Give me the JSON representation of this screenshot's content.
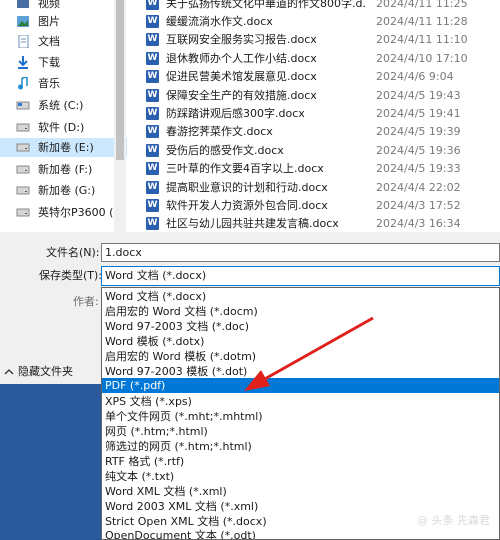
{
  "nav": {
    "items": [
      {
        "label": "视频",
        "icon": "video-icon"
      },
      {
        "label": "图片",
        "icon": "picture-icon"
      },
      {
        "label": "文档",
        "icon": "document-icon"
      },
      {
        "label": "下载",
        "icon": "download-icon"
      },
      {
        "label": "音乐",
        "icon": "music-icon"
      },
      {
        "label": "系统 (C:)",
        "icon": "drive-icon"
      },
      {
        "label": "软件 (D:)",
        "icon": "drive-icon"
      },
      {
        "label": "新加卷 (E:)",
        "icon": "drive-icon",
        "selected": true
      },
      {
        "label": "新加卷 (F:)",
        "icon": "drive-icon"
      },
      {
        "label": "新加卷 (G:)",
        "icon": "drive-icon"
      },
      {
        "label": "英特尔P3600 (H",
        "icon": "drive-icon"
      }
    ]
  },
  "files": [
    {
      "name": "关于弘扬传统文化中華道的作文800字.d...",
      "date": "2024/4/11 11:25"
    },
    {
      "name": "缓缓流淌水作文.docx",
      "date": "2024/4/11 11:28"
    },
    {
      "name": "互联网安全服务实习报告.docx",
      "date": "2024/4/11 11:10"
    },
    {
      "name": "退休教师办个人工作小结.docx",
      "date": "2024/4/10 17:10"
    },
    {
      "name": "促进民营美术馆发展意见.docx",
      "date": "2024/4/6 9:04"
    },
    {
      "name": "保障安全生产的有效措施.docx",
      "date": "2024/4/5 19:43"
    },
    {
      "name": "防踩踏讲观后感300字.docx",
      "date": "2024/4/5 19:41"
    },
    {
      "name": "春游挖荠菜作文.docx",
      "date": "2024/4/5 19:39"
    },
    {
      "name": "受伤后的感受作文.docx",
      "date": "2024/4/5 19:36"
    },
    {
      "name": "三叶草的作文要4百字以上.docx",
      "date": "2024/4/5 19:33"
    },
    {
      "name": "提高职业意识的计划和行动.docx",
      "date": "2024/4/4 22:02"
    },
    {
      "name": "软件开发人力资源外包合同.docx",
      "date": "2024/4/3 17:52"
    },
    {
      "name": "社区与幼儿园共驻共建发言稿.docx",
      "date": "2024/4/3 16:34"
    }
  ],
  "form": {
    "filename_label": "文件名(N):",
    "filename_value": "1.docx",
    "type_label": "保存类型(T):",
    "type_value": "Word 文档 (*.docx)",
    "author_label": "作者:",
    "hide_folders_label": "隐藏文件夹",
    "hide_folders_icon": "chevron-up-icon"
  },
  "dropdown": {
    "options": [
      "Word 文档 (*.docx)",
      "启用宏的 Word 文档 (*.docm)",
      "Word 97-2003 文档 (*.doc)",
      "Word 模板 (*.dotx)",
      "启用宏的 Word 模板 (*.dotm)",
      "Word 97-2003 模板 (*.dot)",
      "PDF (*.pdf)",
      "XPS 文档 (*.xps)",
      "单个文件网页 (*.mht;*.mhtml)",
      "网页 (*.htm;*.html)",
      "筛选过的网页 (*.htm;*.html)",
      "RTF 格式 (*.rtf)",
      "纯文本 (*.txt)",
      "Word XML 文档 (*.xml)",
      "Word 2003 XML 文档 (*.xml)",
      "Strict Open XML 文档 (*.docx)",
      "OpenDocument 文本 (*.odt)"
    ],
    "highlighted": "PDF (*.pdf)"
  },
  "annotation": {
    "icon": "red-arrow-icon",
    "color": "#e0201b"
  },
  "watermark": "@ 头条 先森君",
  "colors": {
    "accent": "#0078d7",
    "selected_nav": "#cce8ff",
    "blue_area": "#2a5a9c"
  }
}
